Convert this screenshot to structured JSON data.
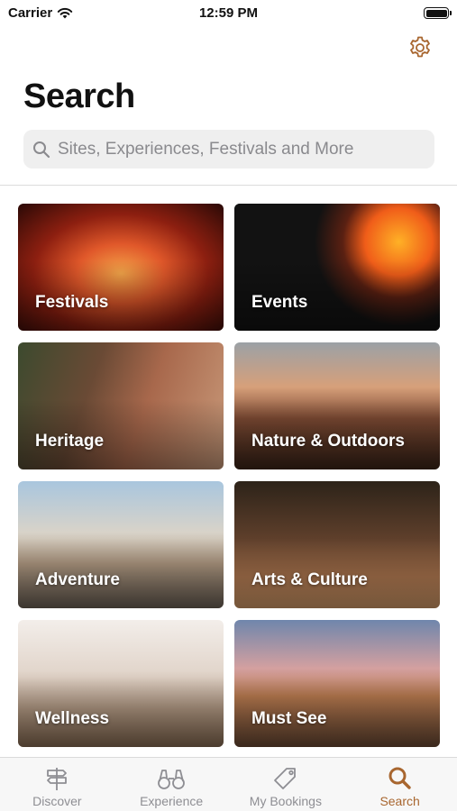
{
  "status_bar": {
    "carrier": "Carrier",
    "time": "12:59 PM"
  },
  "header": {
    "title": "Search",
    "settings_icon": "gear-icon"
  },
  "search": {
    "placeholder": "Sites, Experiences, Festivals and More",
    "value": ""
  },
  "categories": [
    {
      "label": "Festivals"
    },
    {
      "label": "Events"
    },
    {
      "label": "Heritage"
    },
    {
      "label": "Nature & Outdoors"
    },
    {
      "label": "Adventure"
    },
    {
      "label": "Arts & Culture"
    },
    {
      "label": "Wellness"
    },
    {
      "label": "Must See"
    }
  ],
  "tab_bar": {
    "items": [
      {
        "label": "Discover",
        "icon": "signpost-icon"
      },
      {
        "label": "Experience",
        "icon": "binoculars-icon"
      },
      {
        "label": "My Bookings",
        "icon": "tag-icon"
      },
      {
        "label": "Search",
        "icon": "search-icon"
      }
    ],
    "active": "Search"
  },
  "colors": {
    "accent": "#a8662f",
    "inactive": "#8e8e93"
  }
}
